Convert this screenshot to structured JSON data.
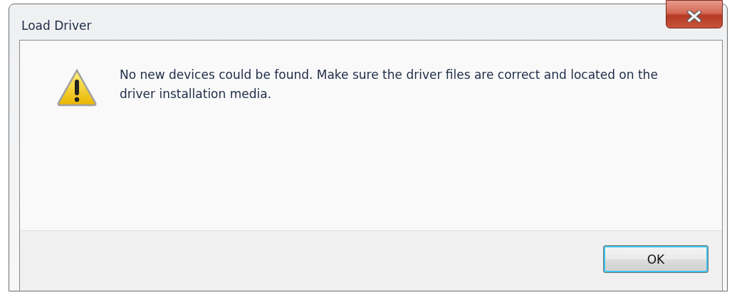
{
  "window": {
    "title": "Load Driver"
  },
  "message": "No new devices could be found. Make sure the driver files are correct and located on the driver installation media.",
  "buttons": [
    {
      "label": "OK",
      "selected": true
    }
  ]
}
